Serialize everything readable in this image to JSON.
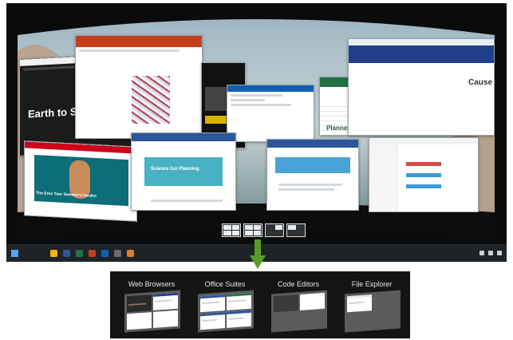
{
  "desktop": {
    "tiles": {
      "media_title": "Earth to Space",
      "espn_caption": "The Eras Tour Sweeter's Verdict",
      "science_title": "Science fun Planning",
      "doc_heading": "Planner",
      "cause_heading": "Cause"
    }
  },
  "groups": [
    {
      "label": "Web Browsers"
    },
    {
      "label": "Office Suites"
    },
    {
      "label": "Code Editors"
    },
    {
      "label": "File Explorer"
    }
  ],
  "colors": {
    "arrow": "#5a9a2a",
    "groups_panel": "#141414",
    "taskbar": "#1e2328",
    "office_red": "#c43e1c",
    "word_blue": "#2b579a",
    "excel_green": "#217346"
  }
}
